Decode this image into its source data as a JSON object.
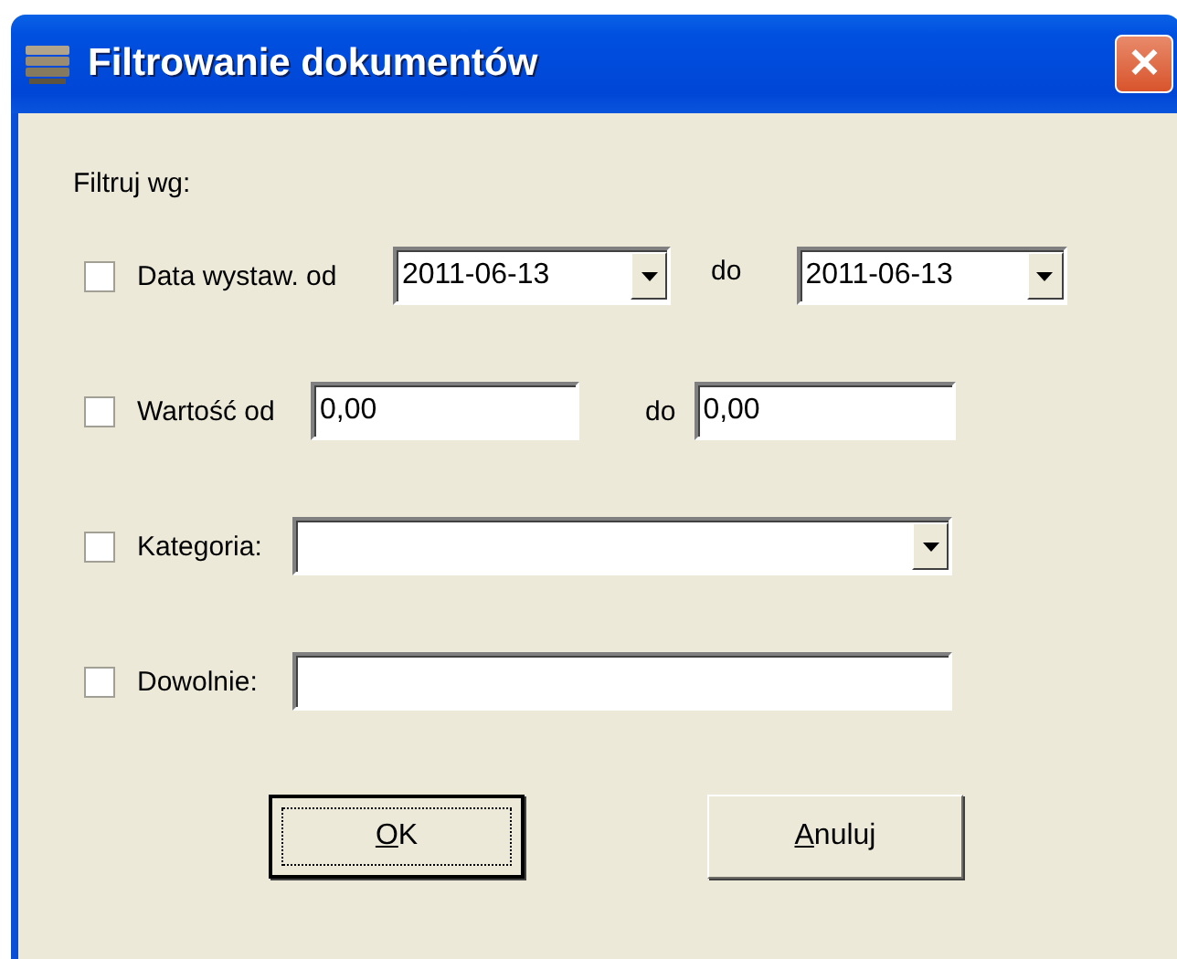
{
  "window": {
    "title": "Filtrowanie dokumentów",
    "close": "✕"
  },
  "intro": "Filtruj wg:",
  "rows": [
    {
      "kind": "dates",
      "checked": false,
      "label": "Data wystaw. od",
      "from": {
        "kind": "combo",
        "value": "2011-06-13"
      },
      "separator": "do",
      "to": {
        "kind": "combo",
        "value": "2011-06-13"
      }
    },
    {
      "kind": "values",
      "checked": false,
      "label": "Wartość od",
      "from": {
        "kind": "text",
        "value": "0,00"
      },
      "separator": "do",
      "to": {
        "kind": "text",
        "value": "0,00"
      }
    },
    {
      "kind": "wide",
      "checked": false,
      "label": "Kategoria:",
      "field": {
        "kind": "combo"
      }
    },
    {
      "kind": "wide",
      "checked": false,
      "label": "Dowolnie:",
      "field": {
        "kind": "text"
      }
    }
  ],
  "buttons": [
    {
      "key": "O",
      "rest": "K",
      "default": true
    },
    {
      "key": "A",
      "rest": "nuluj",
      "default": false
    }
  ]
}
